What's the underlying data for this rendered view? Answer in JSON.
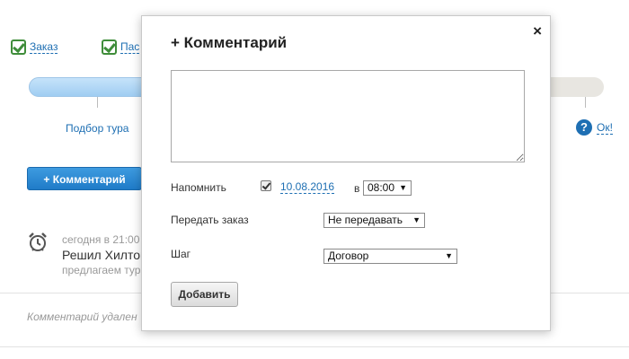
{
  "background": {
    "steps": [
      {
        "label": "Заказ"
      },
      {
        "label": "Пас"
      }
    ],
    "progress_tick_label": "Подбор тура",
    "ok_link": "Ок!",
    "help_icon": "?",
    "comment_button": "+ Комментарий",
    "entry": {
      "time": "сегодня в 21:00",
      "title": "Решил Хилтон",
      "subtitle": "предлагаем тур"
    },
    "deleted_note": "Комментарий удален"
  },
  "modal": {
    "title": "+ Комментарий",
    "comment_value": "",
    "remind": {
      "label": "Напомнить",
      "checked": true,
      "date": "10.08.2016",
      "at": "в",
      "time": "08:00"
    },
    "transfer": {
      "label": "Передать заказ",
      "value": "Не передавать"
    },
    "step": {
      "label": "Шаг",
      "value": "Договор"
    },
    "add_button": "Добавить",
    "close_glyph": "×"
  },
  "colors": {
    "link": "#1e6fb3",
    "check_green": "#3f8d3a",
    "primary_button": "#1f7bc8"
  },
  "icons": [
    "check-icon",
    "help-icon",
    "alarm-clock-icon",
    "close-icon",
    "chevron-down-icon"
  ]
}
